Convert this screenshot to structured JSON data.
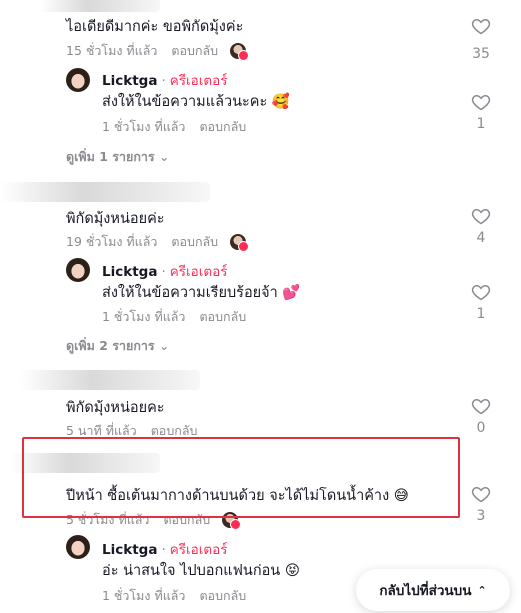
{
  "comments": [
    {
      "text": "ไอเดียดีมากค่ะ ขอพิกัดมุ้งค่ะ",
      "time": "15 ชั่วโมง ที่แล้ว",
      "reply": "ตอบกลับ",
      "likes": "35",
      "reply_item": {
        "author": "Licktga",
        "separator": "·",
        "creator_label": "ครีเอเตอร์",
        "text": "ส่งให้ในข้อความแล้วนะคะ 🥰",
        "time": "1 ชั่วโมง ที่แล้ว",
        "reply": "ตอบกลับ",
        "likes": "1"
      },
      "view_more": "ดูเพิ่ม 1 รายการ"
    },
    {
      "text": "พิกัดมุ้งหน่อยค่ะ",
      "time": "19 ชั่วโมง ที่แล้ว",
      "reply": "ตอบกลับ",
      "likes": "4",
      "reply_item": {
        "author": "Licktga",
        "separator": "·",
        "creator_label": "ครีเอเตอร์",
        "text": "ส่งให้ในข้อความเรียบร้อยจ้า 💕",
        "time": "1 ชั่วโมง ที่แล้ว",
        "reply": "ตอบกลับ",
        "likes": "1"
      },
      "view_more": "ดูเพิ่ม 2 รายการ"
    },
    {
      "text": "พิกัดมุ้งหน่อยคะ",
      "time": "5 นาที ที่แล้ว",
      "reply": "ตอบกลับ",
      "likes": "0"
    },
    {
      "text": "ปีหน้า ซื้อเต้นมากางด้านบนด้วย จะได้ไม่โดนน้ำค้าง 😅",
      "time": "5 ชั่วโมง ที่แล้ว",
      "reply": "ตอบกลับ",
      "likes": "3",
      "reply_item": {
        "author": "Licktga",
        "separator": "·",
        "creator_label": "ครีเอเตอร์",
        "text": "อ่ะ น่าสนใจ ไปบอกแฟนก่อน 😝",
        "time": "1 ชั่วโมง ที่แล้ว",
        "reply": "ตอบกลับ"
      }
    }
  ],
  "back_to_top": "กลับไปที่ส่วนบน",
  "icons": {
    "like": "heart-outline-icon",
    "chevron": "chevron-down-icon",
    "back_top": "double-chevron-up-icon"
  },
  "colors": {
    "creator": "#fe2c55",
    "muted": "#8a8b91",
    "highlight_box": "#e0313f"
  }
}
